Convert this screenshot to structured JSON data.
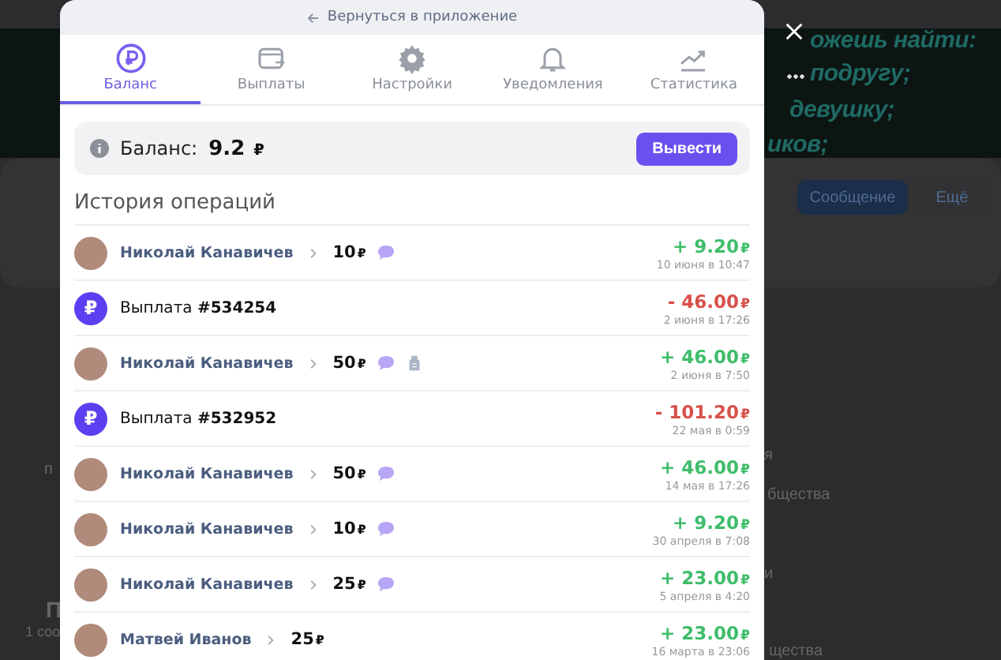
{
  "background": {
    "banner_lines": [
      "ожешь найти:",
      "подругу;",
      "девушку;",
      "иков;"
    ],
    "buttons": [
      "Сообщение",
      "Ещё"
    ],
    "side_fragments": [
      "я",
      "бщества",
      "и",
      "щества"
    ],
    "left_fragments": [
      "п",
      "П",
      "1 соо"
    ]
  },
  "modal": {
    "back_link": "Вернуться в приложение",
    "tabs": [
      {
        "label": "Баланс",
        "selected": true
      },
      {
        "label": "Выплаты",
        "selected": false
      },
      {
        "label": "Настройки",
        "selected": false
      },
      {
        "label": "Уведомления",
        "selected": false
      },
      {
        "label": "Статистика",
        "selected": false
      }
    ],
    "balance": {
      "label": "Баланс:",
      "value": "9.2",
      "currency": "₽",
      "button": "Вывести"
    },
    "history_title": "История операций",
    "operations": [
      {
        "kind": "donation",
        "name": "Николай Канавичев",
        "amount": "10",
        "currency": "₽",
        "comment": true,
        "extra": false,
        "sum": "+ 9.20",
        "sum_currency": "₽",
        "date": "10 июня в 10:47"
      },
      {
        "kind": "payout",
        "badge": "₽",
        "label": "Выплата",
        "number": "#534254",
        "sum": "- 46.00",
        "sum_currency": "₽",
        "date": "2 июня в 17:26"
      },
      {
        "kind": "donation",
        "name": "Николай Канавичев",
        "amount": "50",
        "currency": "₽",
        "comment": true,
        "extra": true,
        "sum": "+ 46.00",
        "sum_currency": "₽",
        "date": "2 июня в 7:50"
      },
      {
        "kind": "payout",
        "badge": "₽",
        "label": "Выплата",
        "number": "#532952",
        "sum": "- 101.20",
        "sum_currency": "₽",
        "date": "22 мая в 0:59"
      },
      {
        "kind": "donation",
        "name": "Николай Канавичев",
        "amount": "50",
        "currency": "₽",
        "comment": true,
        "extra": false,
        "sum": "+ 46.00",
        "sum_currency": "₽",
        "date": "14 мая в 17:26"
      },
      {
        "kind": "donation",
        "name": "Николай Канавичев",
        "amount": "10",
        "currency": "₽",
        "comment": true,
        "extra": false,
        "sum": "+ 9.20",
        "sum_currency": "₽",
        "date": "30 апреля в 7:08"
      },
      {
        "kind": "donation",
        "name": "Николай Канавичев",
        "amount": "25",
        "currency": "₽",
        "comment": true,
        "extra": false,
        "sum": "+ 23.00",
        "sum_currency": "₽",
        "date": "5 апреля в 4:20"
      },
      {
        "kind": "donation",
        "name": "Матвей Иванов",
        "amount": "25",
        "currency": "₽",
        "comment": false,
        "extra": false,
        "sum": "+ 23.00",
        "sum_currency": "₽",
        "date": "16 марта в 23:06"
      }
    ]
  }
}
